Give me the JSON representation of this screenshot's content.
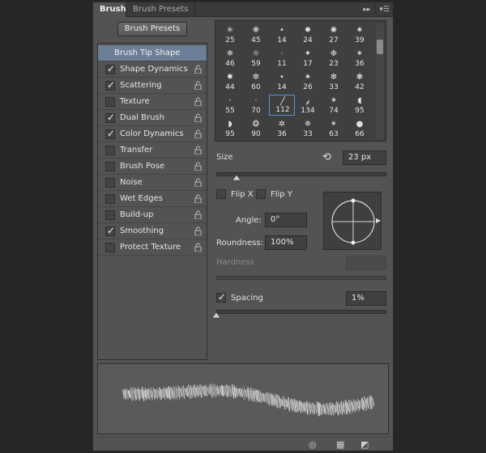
{
  "tabs": [
    {
      "label": "Brush"
    },
    {
      "label": "Brush Presets"
    }
  ],
  "toolbar_icons": [
    "double-arrow-icon",
    "panel-menu-icon"
  ],
  "presets_button": "Brush Presets",
  "settings_list": {
    "header": "Brush Tip Shape",
    "items": [
      {
        "label": "Shape Dynamics",
        "checked": true
      },
      {
        "label": "Scattering",
        "checked": true
      },
      {
        "label": "Texture",
        "checked": false
      },
      {
        "label": "Dual Brush",
        "checked": true
      },
      {
        "label": "Color Dynamics",
        "checked": true
      },
      {
        "label": "Transfer",
        "checked": false
      },
      {
        "label": "Brush Pose",
        "checked": false
      },
      {
        "label": "Noise",
        "checked": false
      },
      {
        "label": "Wet Edges",
        "checked": false
      },
      {
        "label": "Build-up",
        "checked": false
      },
      {
        "label": "Smoothing",
        "checked": true
      },
      {
        "label": "Protect Texture",
        "checked": false
      }
    ]
  },
  "brush_tips": [
    [
      "25",
      "45",
      "14",
      "24",
      "27",
      "39"
    ],
    [
      "46",
      "59",
      "11",
      "17",
      "23",
      "36"
    ],
    [
      "44",
      "60",
      "14",
      "26",
      "33",
      "42"
    ],
    [
      "55",
      "70",
      "112",
      "134",
      "74",
      "95"
    ],
    [
      "95",
      "90",
      "36",
      "33",
      "63",
      "66"
    ]
  ],
  "selected_tip": {
    "row": 3,
    "col": 2
  },
  "size": {
    "label": "Size",
    "value": "23 px",
    "slider_fraction": 0.12
  },
  "flip_x": {
    "label": "Flip X",
    "checked": false
  },
  "flip_y": {
    "label": "Flip Y",
    "checked": false
  },
  "angle": {
    "label": "Angle:",
    "value": "0°"
  },
  "roundness": {
    "label": "Roundness:",
    "value": "100%"
  },
  "hardness": {
    "label": "Hardness",
    "value": ""
  },
  "spacing": {
    "label": "Spacing",
    "value": "1%",
    "checked": true,
    "slider_fraction": 0.0
  }
}
